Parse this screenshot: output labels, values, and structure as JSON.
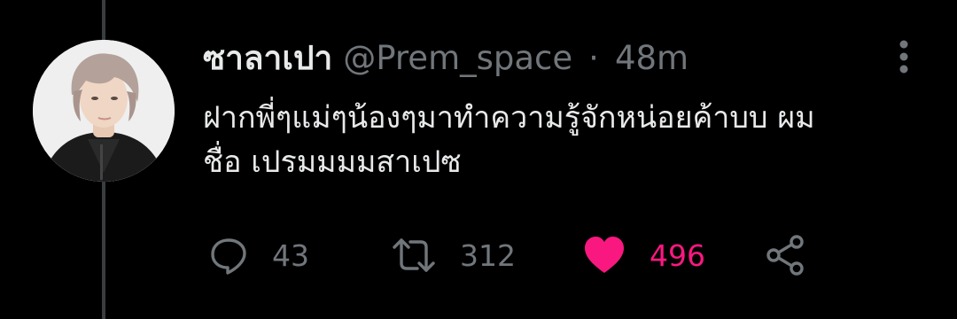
{
  "tweet": {
    "display_name": "ซาลาเปา",
    "handle": "@Prem_space",
    "separator": "·",
    "time": "48m",
    "text_lines": [
      "ฝากพี่ๆแม่ๆน้องๆมาทำความรู้จักหน่อยค้าบบ ผม",
      "ชื่อ เปรมมมมสาเปซ"
    ]
  },
  "actions": {
    "reply": {
      "icon": "reply-icon",
      "count": "43"
    },
    "retweet": {
      "icon": "retweet-icon",
      "count": "312"
    },
    "like": {
      "icon": "heart-icon",
      "count": "496",
      "liked": true
    },
    "share": {
      "icon": "share-icon"
    }
  },
  "colors": {
    "background": "#000000",
    "primary_text": "#e7e9ea",
    "secondary_text": "#71767b",
    "like_accent": "#f91880",
    "thread_line": "#3a3d40"
  }
}
